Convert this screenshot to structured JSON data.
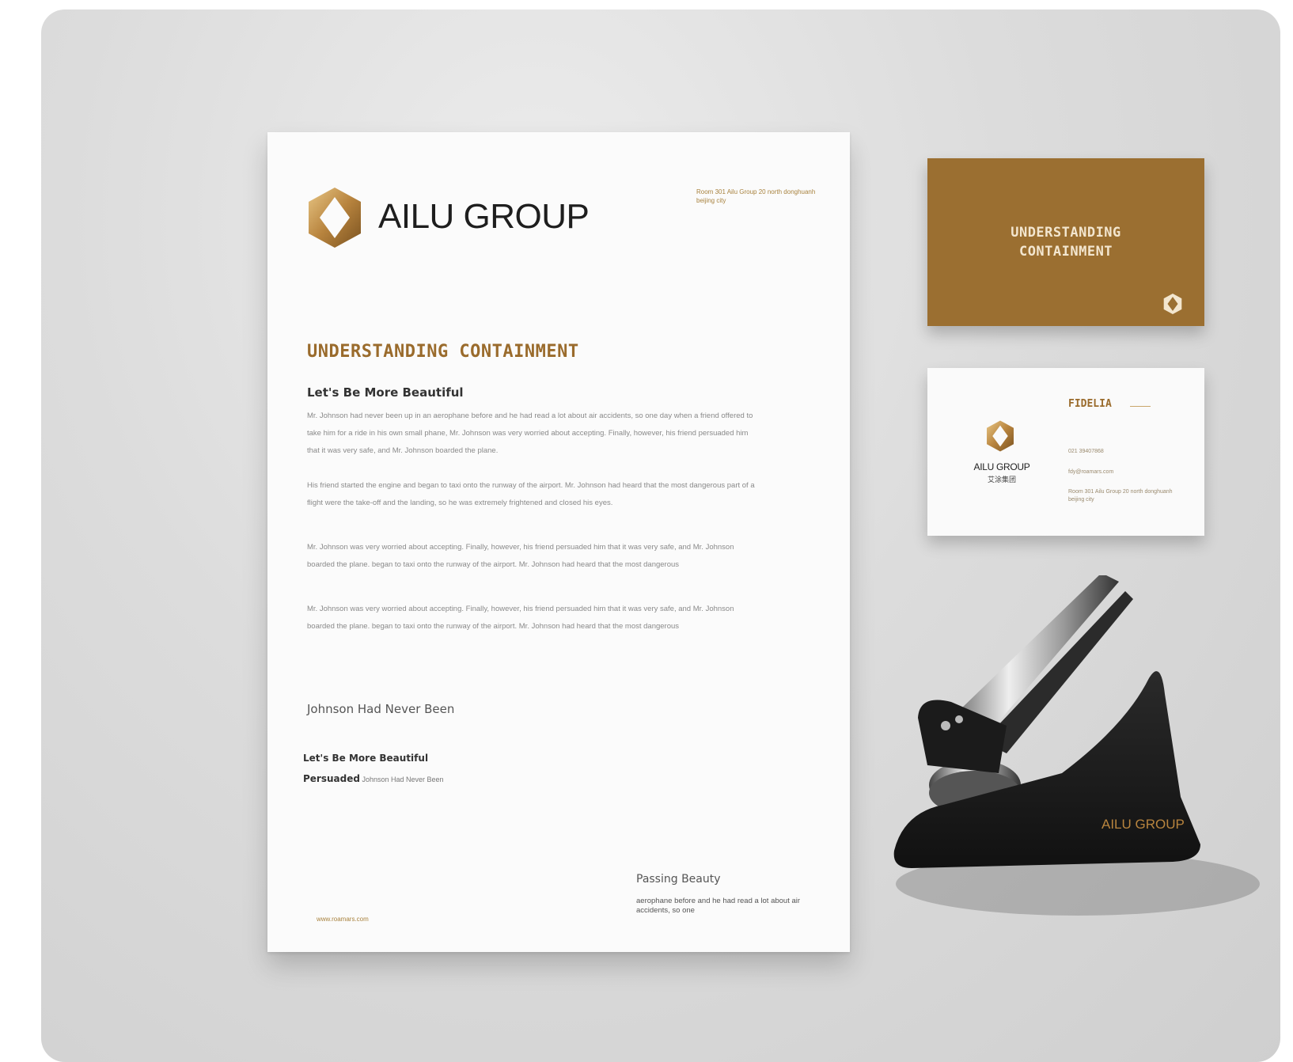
{
  "colors": {
    "gold": "#9b6f31",
    "gold_text": "#9a6b2c",
    "dark": "#1e1e1e",
    "embosser": "#1c1c1c"
  },
  "letterhead": {
    "logo_icon": "hexagon-diamond-logo",
    "brand": "AILU GROUP",
    "address": "Room 301 Ailu Group 20 north donghuanh beijing city",
    "headline": "UNDERSTANDING CONTAINMENT",
    "subheading": "Let's Be More Beautiful",
    "paragraphs": [
      "Mr. Johnson had never been up in an aerophane before and he had read a lot about air accidents, so one day when a friend offered to take him for a ride in his own small phane, Mr. Johnson was very worried about accepting. Finally, however, his friend persuaded him that it was very safe, and Mr. Johnson boarded the plane.",
      "His friend started the engine and began to taxi onto the runway of the airport. Mr. Johnson had heard that the most dangerous part of a flight were the take-off and the landing, so he was extremely frightened and closed his eyes.",
      "Mr. Johnson was very worried about accepting. Finally, however, his friend persuaded him that it was very safe, and Mr. Johnson boarded the plane. began to taxi onto the runway of the airport. Mr. Johnson had heard that the most dangerous",
      "Mr. Johnson was very worried about accepting. Finally, however, his friend persuaded him that it was very safe, and Mr. Johnson boarded the plane. began to taxi onto the runway of the airport. Mr. Johnson had heard that the most dangerous"
    ],
    "signature_name": "Johnson Had Never Been",
    "closing_heading": "Let's Be More Beautiful",
    "closing_label": "Persuaded",
    "closing_text": "Johnson Had Never Been",
    "passing_title": "Passing Beauty",
    "passing_text": "aerophane before and he had read a lot about air accidents, so one",
    "website": "www.roamars.com"
  },
  "card_front": {
    "title": "UNDERSTANDING\nCONTAINMENT",
    "logo_icon": "hexagon-diamond-logo"
  },
  "card_back": {
    "logo_icon": "hexagon-diamond-logo",
    "brand": "AILU GROUP",
    "brand_cn": "艾涂集团",
    "name": "FIDELIA",
    "phone": "021 39407868",
    "email": "fdy@roamars.com",
    "address": "Room 301 Ailu Group 20 north donghuanh beijing city"
  },
  "embosser": {
    "label": "AILU GROUP"
  }
}
